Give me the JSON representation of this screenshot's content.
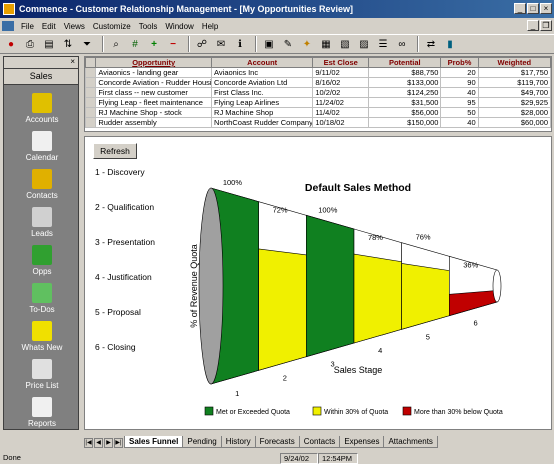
{
  "window": {
    "title": "Commence - Customer Relationship Management - [My Opportunities Review]"
  },
  "menu": [
    "File",
    "Edit",
    "Views",
    "Customize",
    "Tools",
    "Window",
    "Help"
  ],
  "sidebar": {
    "tab": "Sales",
    "items": [
      {
        "label": "Accounts",
        "icon": "accounts-icon",
        "color": "#e0c000"
      },
      {
        "label": "Calendar",
        "icon": "calendar-icon",
        "color": "#f0f0f0"
      },
      {
        "label": "Contacts",
        "icon": "contacts-icon",
        "color": "#e0b000"
      },
      {
        "label": "Leads",
        "icon": "phone-icon",
        "color": "#d0d0d0"
      },
      {
        "label": "Opps",
        "icon": "money-icon",
        "color": "#30a030"
      },
      {
        "label": "To-Dos",
        "icon": "todo-icon",
        "color": "#60c060"
      },
      {
        "label": "Whats New",
        "icon": "new-icon",
        "color": "#f0e000"
      },
      {
        "label": "Price List",
        "icon": "book-icon",
        "color": "#e0e0e0"
      },
      {
        "label": "Reports",
        "icon": "reports-icon",
        "color": "#f0f0f0"
      }
    ]
  },
  "grid": {
    "columns": [
      "Opportunity",
      "Account",
      "Est Close",
      "Potential",
      "Prob%",
      "Weighted"
    ],
    "rows": [
      [
        "Aviaonics - landing gear",
        "Aviaonics Inc",
        "9/11/02",
        "$88,750",
        "20",
        "$17,750"
      ],
      [
        "Concorde Aviation - Rudder Housin",
        "Concorde Aviation Ltd",
        "8/16/02",
        "$133,000",
        "90",
        "$119,700"
      ],
      [
        "First class -- new customer",
        "First Class Inc.",
        "10/2/02",
        "$124,250",
        "40",
        "$49,700"
      ],
      [
        "Flying Leap - fleet maintenance",
        "Flying Leap Airlines",
        "11/24/02",
        "$31,500",
        "95",
        "$29,925"
      ],
      [
        "RJ Machine Shop - stock",
        "RJ Machine Shop",
        "11/4/02",
        "$56,000",
        "50",
        "$28,000"
      ],
      [
        "Rudder assembly",
        "NorthCoast Rudder Company",
        "10/18/02",
        "$150,000",
        "40",
        "$60,000"
      ]
    ]
  },
  "panel": {
    "refresh_label": "Refresh",
    "stages": [
      "1 - Discovery",
      "2 - Qualification",
      "3 - Presentation",
      "4 - Justification",
      "5 - Proposal",
      "6 - Closing"
    ]
  },
  "chart_data": {
    "type": "funnel",
    "title": "Default Sales Method",
    "xlabel": "Sales Stage",
    "ylabel": "% of Revenue Quota",
    "categories": [
      "1",
      "2",
      "3",
      "4",
      "5",
      "6"
    ],
    "values": [
      100,
      72,
      100,
      78,
      76,
      36
    ],
    "value_labels": [
      "100%",
      "72%",
      "100%",
      "78%",
      "76%",
      "36%"
    ],
    "status": [
      "met",
      "within",
      "met",
      "within",
      "within",
      "below"
    ],
    "legend": [
      {
        "key": "met",
        "label": "Met or Exceeded Quota",
        "color": "#108020"
      },
      {
        "key": "within",
        "label": "Within 30% of Quota",
        "color": "#f0f000"
      },
      {
        "key": "below",
        "label": "More than 30% below Quota",
        "color": "#c00000"
      }
    ]
  },
  "tabs": [
    "Sales Funnel",
    "Pending",
    "History",
    "Forecasts",
    "Contacts",
    "Expenses",
    "Attachments"
  ],
  "active_tab": "Sales Funnel",
  "status": {
    "text": "Done",
    "date": "9/24/02",
    "time": "12:54PM"
  }
}
